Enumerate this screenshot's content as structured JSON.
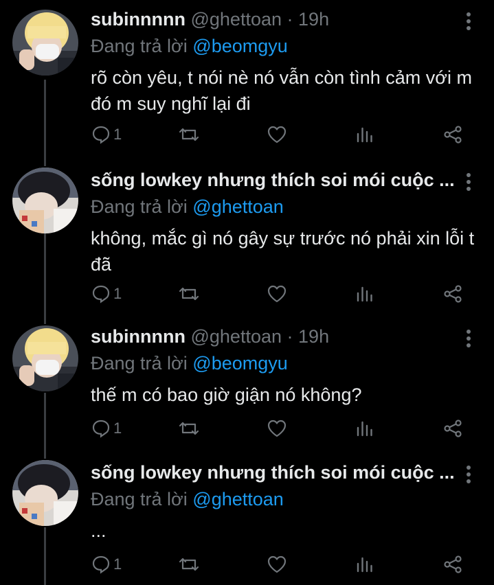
{
  "tweets": [
    {
      "display_name": "subinnnnn",
      "handle": "@ghettoan",
      "separator": "·",
      "time": "19h",
      "reply_prefix": "Đang trả lời",
      "reply_to": "@beomgyu",
      "text": "rõ còn yêu, t nói nè nó vẫn còn tình cảm với m đó m suy nghĩ lại đi",
      "reply_count": "1",
      "avatar_icon": "avatar-blonde-mask"
    },
    {
      "display_name": "sống lowkey nhưng thích soi mói cuộc ...",
      "handle": "",
      "separator": "",
      "time": "",
      "reply_prefix": "Đang trả lời",
      "reply_to": "@ghettoan",
      "text": "không, mắc gì nó gây sự trước nó phải xin lỗi t đã",
      "reply_count": "1",
      "avatar_icon": "avatar-dark-hair"
    },
    {
      "display_name": "subinnnnn",
      "handle": "@ghettoan",
      "separator": "·",
      "time": "19h",
      "reply_prefix": "Đang trả lời",
      "reply_to": "@beomgyu",
      "text": "thế m có bao giờ giận nó không?",
      "reply_count": "1",
      "avatar_icon": "avatar-blonde-mask"
    },
    {
      "display_name": "sống lowkey nhưng thích soi mói cuộc ...",
      "handle": "",
      "separator": "",
      "time": "",
      "reply_prefix": "Đang trả lời",
      "reply_to": "@ghettoan",
      "text": "...",
      "reply_count": "1",
      "avatar_icon": "avatar-dark-hair"
    }
  ],
  "colors": {
    "background": "#000000",
    "text": "#e7e9ea",
    "muted": "#71767b",
    "mention": "#1d9bf0",
    "thread_line": "#3a3d41"
  },
  "icons": [
    "reply-icon",
    "retweet-icon",
    "like-icon",
    "analytics-icon",
    "share-icon",
    "more-icon"
  ]
}
